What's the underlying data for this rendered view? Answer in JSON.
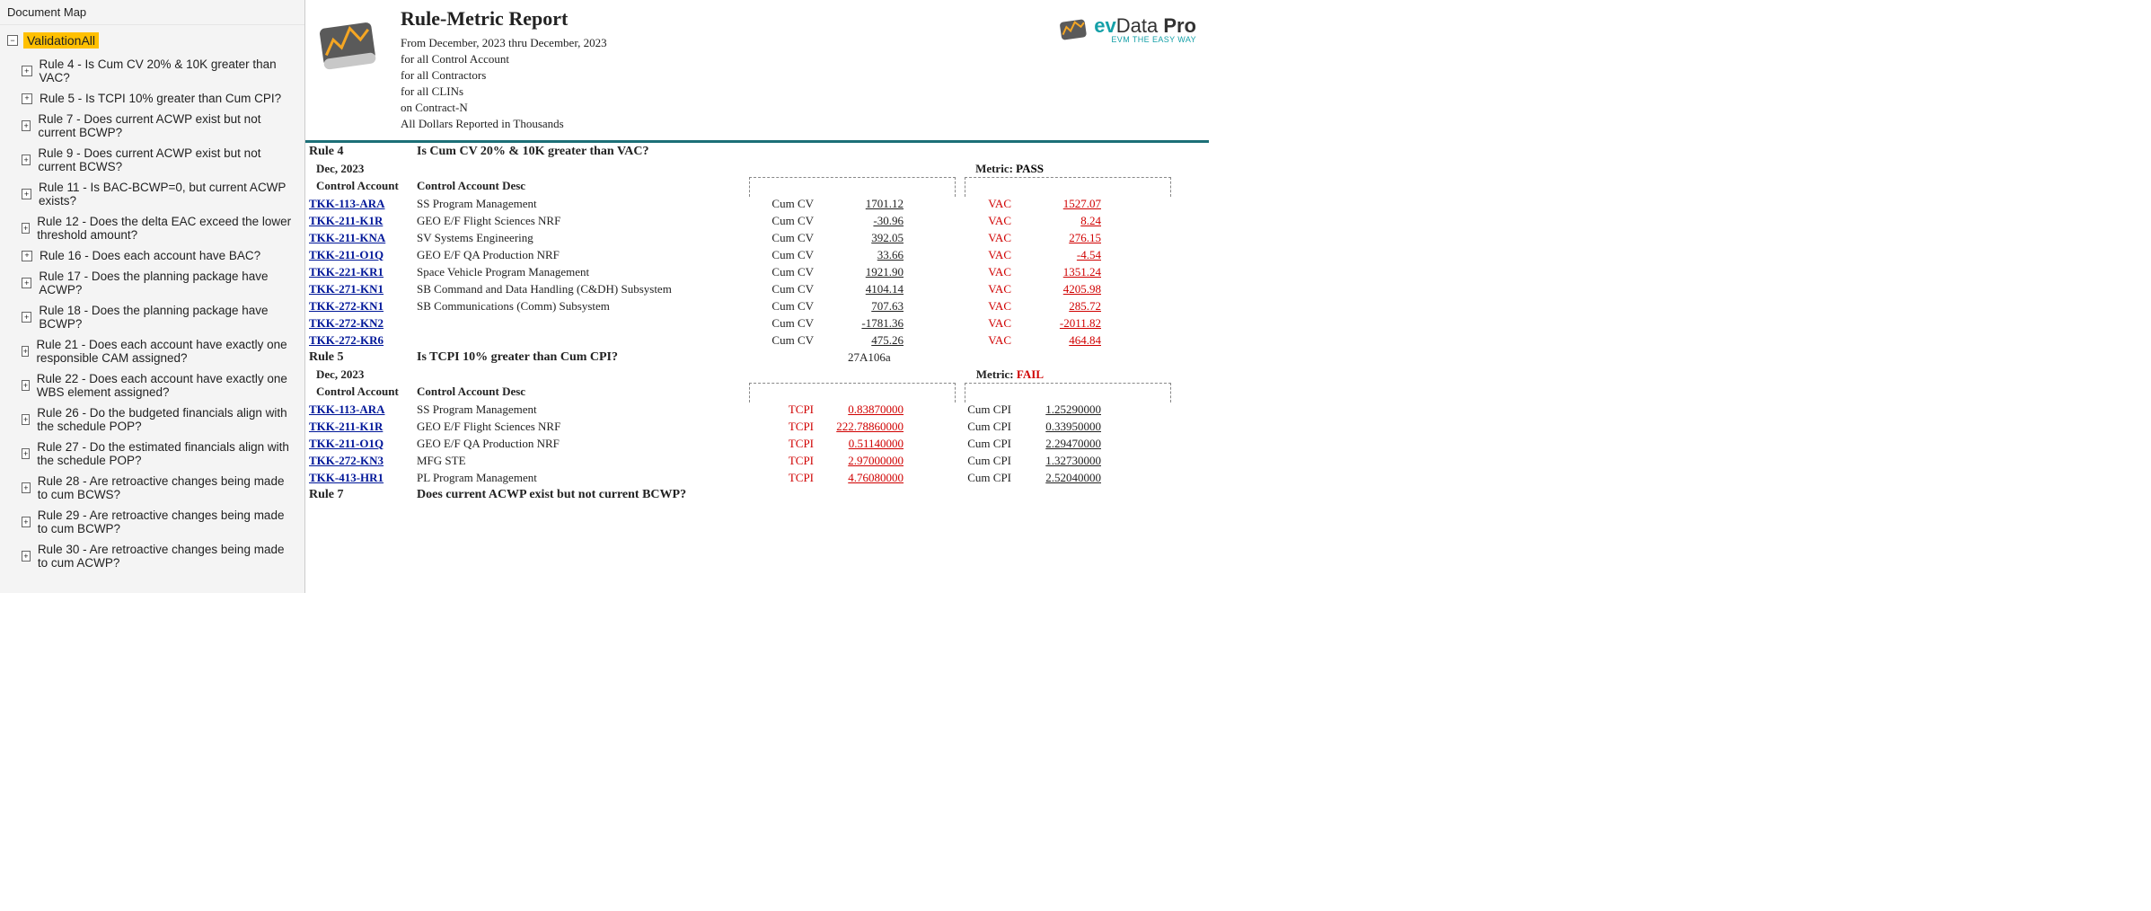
{
  "pane_title": "Document Map",
  "tree_root": "ValidationAll",
  "tree_items": [
    "Rule 4 - Is Cum CV 20% & 10K greater than VAC?",
    "Rule 5 - Is TCPI 10% greater than Cum CPI?",
    "Rule 7 - Does current ACWP exist but not current BCWP?",
    "Rule 9 - Does current ACWP exist but not current BCWS?",
    "Rule 11 - Is BAC-BCWP=0, but current ACWP exists?",
    "Rule 12 - Does the delta EAC exceed the lower threshold amount?",
    "Rule 16 - Does each account have BAC?",
    "Rule 17 - Does the planning package have ACWP?",
    "Rule 18 - Does the planning package have BCWP?",
    "Rule 21 - Does each account have exactly one responsible CAM assigned?",
    "Rule 22 - Does each account have exactly one WBS element assigned?",
    "Rule 26 - Do the budgeted financials align with the schedule POP?",
    "Rule 27 - Do the estimated financials align with the schedule POP?",
    "Rule 28 - Are retroactive changes being made to cum BCWS?",
    "Rule 29 - Are retroactive changes being made to cum BCWP?",
    "Rule 30 - Are retroactive changes being made to cum ACWP?"
  ],
  "report": {
    "title": "Rule-Metric Report",
    "subs": [
      "From December, 2023 thru December, 2023",
      "for all Control Account",
      "for all Contractors",
      "for all CLINs",
      "on Contract-N",
      "All Dollars Reported in Thousands"
    ],
    "brand1": "evData Pro",
    "brand2": "EVM THE EASY WAY"
  },
  "col_ca": "Control Account",
  "col_ca_desc": "Control Account Desc",
  "metric_label": "Metric:",
  "rule4": {
    "id": "Rule 4",
    "question": "Is Cum CV 20% & 10K greater than VAC?",
    "note": "",
    "date": "Dec, 2023",
    "metric_status": "PASS",
    "m1_label": "Cum CV",
    "m2_label": "VAC",
    "rows": [
      {
        "acct": "TKK-113-ARA",
        "desc": "SS Program Management",
        "m1": "1701.12",
        "m2": "1527.07"
      },
      {
        "acct": "TKK-211-K1R",
        "desc": "GEO E/F Flight Sciences NRF",
        "m1": "-30.96",
        "m2": "8.24"
      },
      {
        "acct": "TKK-211-KNA",
        "desc": "SV Systems Engineering",
        "m1": "392.05",
        "m2": "276.15"
      },
      {
        "acct": "TKK-211-O1Q",
        "desc": "GEO E/F QA Production NRF",
        "m1": "33.66",
        "m2": "-4.54"
      },
      {
        "acct": "TKK-221-KR1",
        "desc": "Space Vehicle Program Management",
        "m1": "1921.90",
        "m2": "1351.24"
      },
      {
        "acct": "TKK-271-KN1",
        "desc": "SB Command and Data Handling (C&DH) Subsystem",
        "m1": "4104.14",
        "m2": "4205.98"
      },
      {
        "acct": "TKK-272-KN1",
        "desc": "SB Communications (Comm) Subsystem",
        "m1": "707.63",
        "m2": "285.72"
      },
      {
        "acct": "TKK-272-KN2",
        "desc": "",
        "m1": "-1781.36",
        "m2": "-2011.82"
      },
      {
        "acct": "TKK-272-KR6",
        "desc": "",
        "m1": "475.26",
        "m2": "464.84"
      }
    ]
  },
  "rule5": {
    "id": "Rule 5",
    "question": "Is TCPI 10% greater than Cum CPI?",
    "note": "27A106a",
    "date": "Dec, 2023",
    "metric_status": "FAIL",
    "m1_label": "TCPI",
    "m2_label": "Cum CPI",
    "rows": [
      {
        "acct": "TKK-113-ARA",
        "desc": "SS Program Management",
        "m1": "0.83870000",
        "m2": "1.25290000"
      },
      {
        "acct": "TKK-211-K1R",
        "desc": "GEO E/F Flight Sciences NRF",
        "m1": "222.78860000",
        "m2": "0.33950000"
      },
      {
        "acct": "TKK-211-O1Q",
        "desc": "GEO E/F QA Production NRF",
        "m1": "0.51140000",
        "m2": "2.29470000"
      },
      {
        "acct": "TKK-272-KN3",
        "desc": "MFG STE",
        "m1": "2.97000000",
        "m2": "1.32730000"
      },
      {
        "acct": "TKK-413-HR1",
        "desc": "PL Program Management",
        "m1": "4.76080000",
        "m2": "2.52040000"
      }
    ]
  },
  "rule7": {
    "id": "Rule 7",
    "question": "Does current ACWP exist but not current BCWP?"
  }
}
